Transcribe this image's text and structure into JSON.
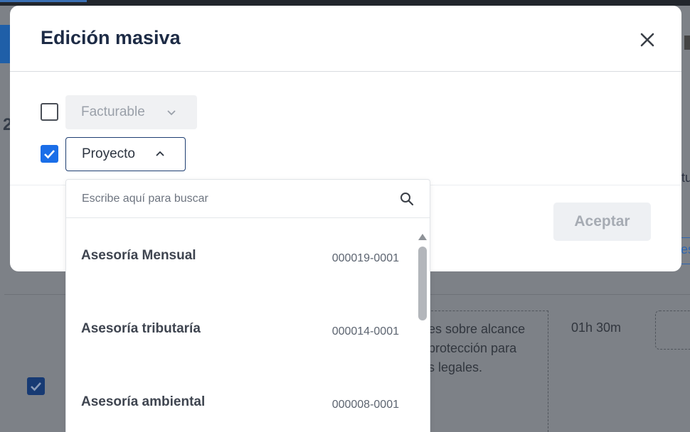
{
  "modal": {
    "title": "Edición masiva",
    "close_icon": "close-icon",
    "accept_label": "Aceptar"
  },
  "fields": [
    {
      "checked": false,
      "label": "Facturable",
      "state": "disabled",
      "icon": "chevron-down-icon"
    },
    {
      "checked": true,
      "label": "Proyecto",
      "state": "open",
      "icon": "chevron-up-icon"
    }
  ],
  "dropdown": {
    "search_placeholder": "Escribe aquí para buscar",
    "search_icon": "search-icon",
    "items": [
      {
        "name": "Asesoría Mensual",
        "code": "000019-0001"
      },
      {
        "name": "Asesoría tributaría",
        "code": "000014-0001"
      },
      {
        "name": "Asesoría ambiental",
        "code": "000008-0001"
      }
    ]
  },
  "background": {
    "number": "2",
    "cell_text": "es sobre alcance\nprotección para\ns legales.",
    "time": "01h 30m",
    "right_text": "tu",
    "right_link": "es"
  },
  "colors": {
    "accent": "#1a6ee8",
    "title": "#1d2b45",
    "overlay": "#7d8187",
    "active_border": "#1e3e71"
  }
}
